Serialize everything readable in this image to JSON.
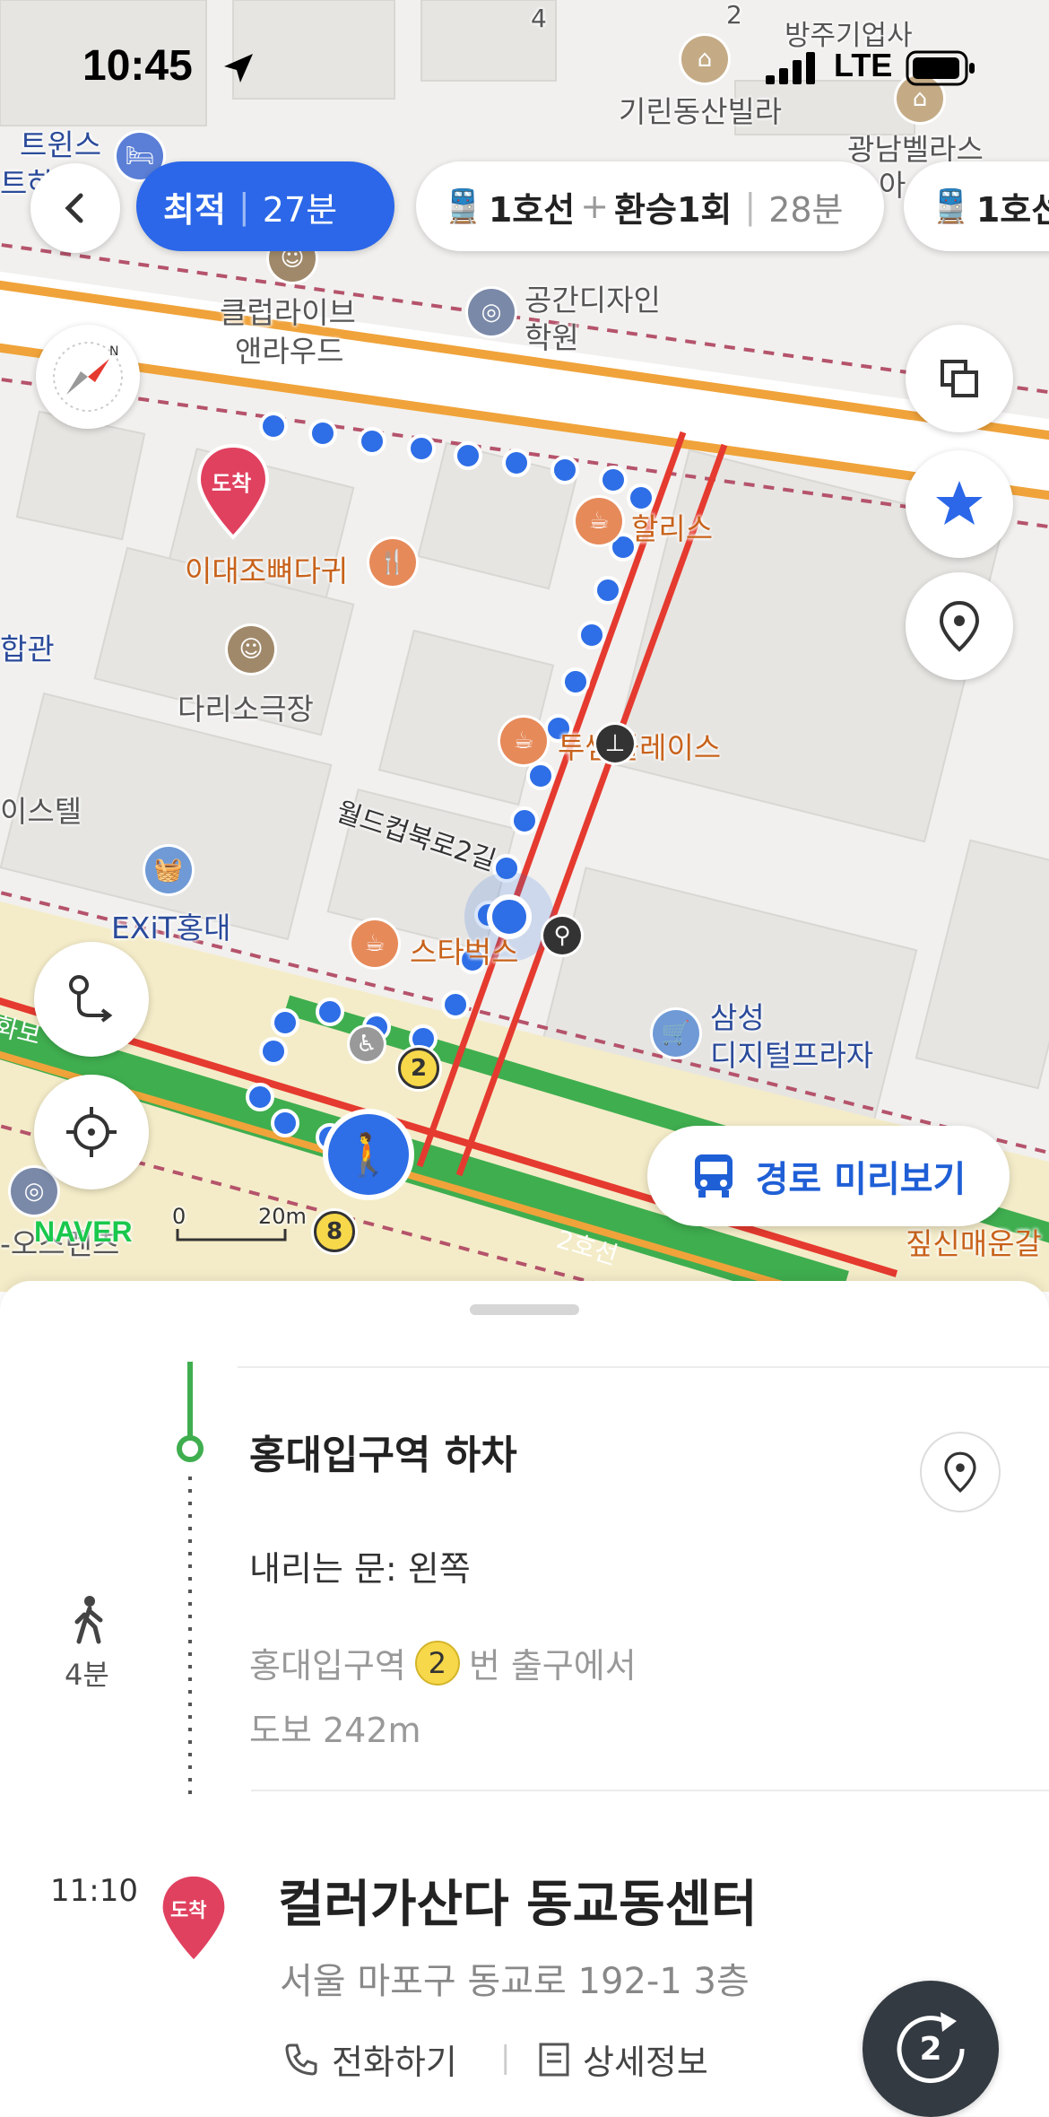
{
  "status_bar": {
    "time": "10:45",
    "network": "LTE"
  },
  "route_options": [
    {
      "label": "최적",
      "duration": "27분"
    },
    {
      "line": "1호선",
      "plus": "+",
      "transfer": "환승1회",
      "duration": "28분"
    },
    {
      "line": "1호선"
    }
  ],
  "map": {
    "labels": {
      "twins": "트윈스",
      "teu": "트하",
      "building_4": "4",
      "building_2": "2",
      "bangju": "방주기업사",
      "kirin": "기린동산빌라",
      "gwangnam_1": "광남벨라스",
      "gwangnam_2": "아",
      "club_1": "클럽라이브",
      "club_2": "앤라우드",
      "space_1": "공간디자인",
      "space_2": "학원",
      "hollys": "할리스",
      "idae": "이대조뼈다귀",
      "hapgwan": "합관",
      "dari": "다리소극장",
      "twosome": "투썸플레이스",
      "istel": "이스텔",
      "worldcup": "월드컵북로2길",
      "exit": "EXiT홍대",
      "starbucks": "스타벅스",
      "samsung_1": "삼성",
      "samsung_2": "디지털프라자",
      "line2": "2호선",
      "naver": "NAVER",
      "scale_zero": "0",
      "scale": "20m",
      "exit2": "2",
      "exit8": "8",
      "jjamppong": "짚신매운갈",
      "osrent": "-오스렌츠",
      "arrival_pin": "도착",
      "edge_bottom": "화보"
    },
    "preview_button": "경로 미리보기",
    "accent_color": "#2b67e8",
    "route_color": "#e53a2f",
    "walk_color": "#2e6ee6"
  },
  "sheet": {
    "station_title": "홍대입구역 하차",
    "door": "내리는 문: 왼쪽",
    "walk_time": "4분",
    "exit_prefix": "홍대입구역",
    "exit_number": "2",
    "exit_suffix": "번 출구에서",
    "walk_distance": "도보 242m",
    "arrival_time": "11:10",
    "arrival_badge": "도착",
    "destination": "컬러가산다 동교동센터",
    "address": "서울 마포구 동교로 192-1 3층",
    "call": "전화하기",
    "details": "상세정보",
    "fab_number": "2"
  }
}
